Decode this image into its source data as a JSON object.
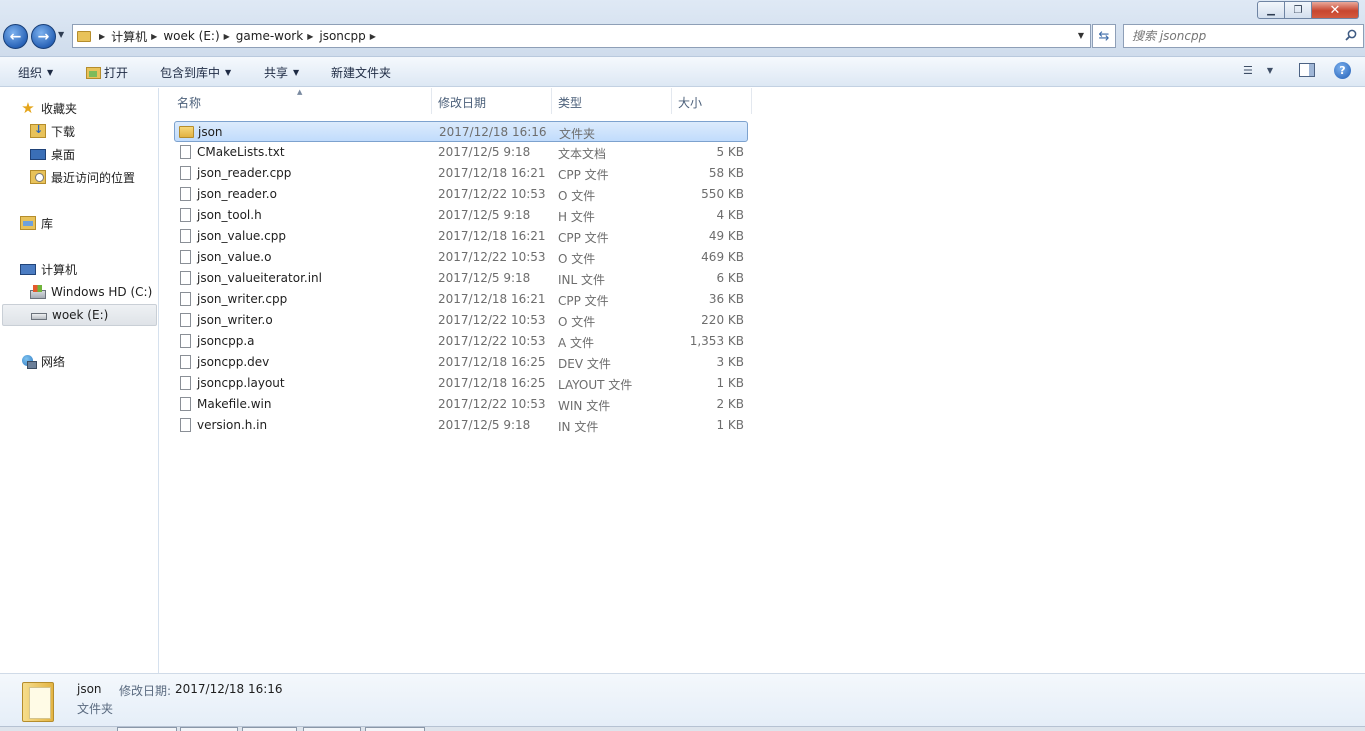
{
  "window": {
    "controls": {
      "minimize": "▁",
      "maximize": "❐",
      "close": "✕"
    }
  },
  "address": {
    "crumbs": [
      "计算机",
      "woek (E:)",
      "game-work",
      "jsoncpp"
    ]
  },
  "search": {
    "placeholder": "搜索 jsoncpp"
  },
  "toolbar": {
    "organize": "组织",
    "open": "打开",
    "include_in_library": "包含到库中",
    "share": "共享",
    "new_folder": "新建文件夹"
  },
  "nav": {
    "favorites": "收藏夹",
    "downloads": "下载",
    "desktop": "桌面",
    "recent": "最近访问的位置",
    "libraries": "库",
    "computer": "计算机",
    "drive_c": "Windows HD (C:)",
    "drive_e": "woek (E:)",
    "network": "网络"
  },
  "columns": {
    "name": "名称",
    "date": "修改日期",
    "type": "类型",
    "size": "大小"
  },
  "files": [
    {
      "name": "json",
      "date": "2017/12/18 16:16",
      "type": "文件夹",
      "size": "",
      "folder": true
    },
    {
      "name": "CMakeLists.txt",
      "date": "2017/12/5 9:18",
      "type": "文本文档",
      "size": "5 KB"
    },
    {
      "name": "json_reader.cpp",
      "date": "2017/12/18 16:21",
      "type": "CPP 文件",
      "size": "58 KB"
    },
    {
      "name": "json_reader.o",
      "date": "2017/12/22 10:53",
      "type": "O 文件",
      "size": "550 KB"
    },
    {
      "name": "json_tool.h",
      "date": "2017/12/5 9:18",
      "type": "H 文件",
      "size": "4 KB"
    },
    {
      "name": "json_value.cpp",
      "date": "2017/12/18 16:21",
      "type": "CPP 文件",
      "size": "49 KB"
    },
    {
      "name": "json_value.o",
      "date": "2017/12/22 10:53",
      "type": "O 文件",
      "size": "469 KB"
    },
    {
      "name": "json_valueiterator.inl",
      "date": "2017/12/5 9:18",
      "type": "INL 文件",
      "size": "6 KB"
    },
    {
      "name": "json_writer.cpp",
      "date": "2017/12/18 16:21",
      "type": "CPP 文件",
      "size": "36 KB"
    },
    {
      "name": "json_writer.o",
      "date": "2017/12/22 10:53",
      "type": "O 文件",
      "size": "220 KB"
    },
    {
      "name": "jsoncpp.a",
      "date": "2017/12/22 10:53",
      "type": "A 文件",
      "size": "1,353 KB"
    },
    {
      "name": "jsoncpp.dev",
      "date": "2017/12/18 16:25",
      "type": "DEV 文件",
      "size": "3 KB"
    },
    {
      "name": "jsoncpp.layout",
      "date": "2017/12/18 16:25",
      "type": "LAYOUT 文件",
      "size": "1 KB"
    },
    {
      "name": "Makefile.win",
      "date": "2017/12/22 10:53",
      "type": "WIN 文件",
      "size": "2 KB"
    },
    {
      "name": "version.h.in",
      "date": "2017/12/5 9:18",
      "type": "IN 文件",
      "size": "1 KB"
    }
  ],
  "details": {
    "name": "json",
    "date_label": "修改日期:",
    "date": "2017/12/18 16:16",
    "type": "文件夹"
  },
  "colors": {
    "selection_border": "#7da2ce",
    "selection_fill": "#c1dcfc",
    "folder": "#e8c25a"
  }
}
